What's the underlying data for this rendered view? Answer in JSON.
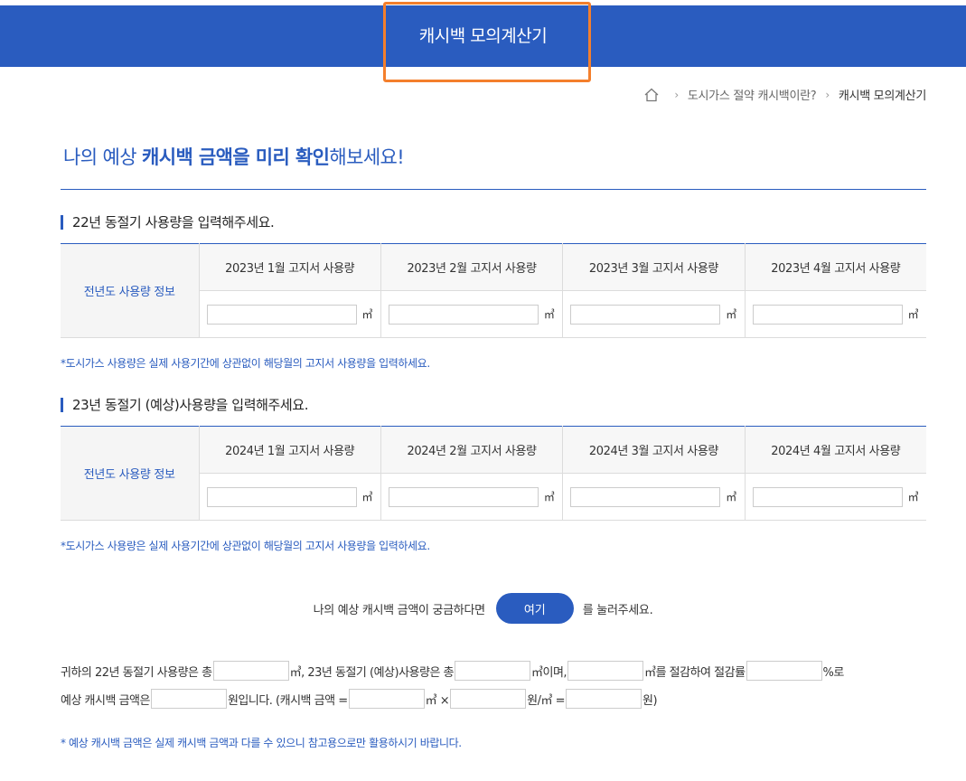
{
  "header": {
    "title": "캐시백 모의계산기"
  },
  "breadcrumb": {
    "items": [
      "도시가스 절약 캐시백이란?",
      "캐시백 모의계산기"
    ],
    "separator": "›"
  },
  "headline": {
    "prefix": "나의 예상 ",
    "bold": "캐시백 금액을 미리 확인",
    "suffix": "해보세요!"
  },
  "section1": {
    "title": "22년 동절기 사용량을 입력해주세요.",
    "row_label": "전년도 사용량 정보",
    "columns": [
      "2023년 1월 고지서 사용량",
      "2023년 2월 고지서 사용량",
      "2023년 3월 고지서 사용량",
      "2023년 4월 고지서 사용량"
    ],
    "unit": "㎥",
    "note": "*도시가스 사용량은 실제 사용기간에 상관없이 해당월의 고지서 사용량을 입력하세요."
  },
  "section2": {
    "title": "23년 동절기 (예상)사용량을 입력해주세요.",
    "row_label": "전년도 사용량 정보",
    "columns": [
      "2024년 1월 고지서 사용량",
      "2024년 2월 고지서 사용량",
      "2024년 3월 고지서 사용량",
      "2024년 4월 고지서 사용량"
    ],
    "unit": "㎥",
    "note": "*도시가스 사용량은 실제 사용기간에 상관없이 해당월의 고지서 사용량을 입력하세요."
  },
  "cta": {
    "before": "나의 예상 캐시백 금액이 궁금하다면",
    "button": "여기",
    "after": "를 눌러주세요."
  },
  "result": {
    "line1": [
      "귀하의 22년 동절기 사용량은 총",
      "㎥, 23년 동절기 (예상)사용량은 총",
      "㎥이며,",
      "㎥를 절감하여 절감률",
      "%로"
    ],
    "line2": [
      "예상 캐시백 금액은",
      "원입니다. (캐시백 금액 =",
      "㎥ ×",
      "원/㎥ =",
      "원)"
    ]
  },
  "footnote": "* 예상 캐시백 금액은 실제 캐시백 금액과 다를 수 있으니 참고용으로만 활용하시기 바랍니다."
}
